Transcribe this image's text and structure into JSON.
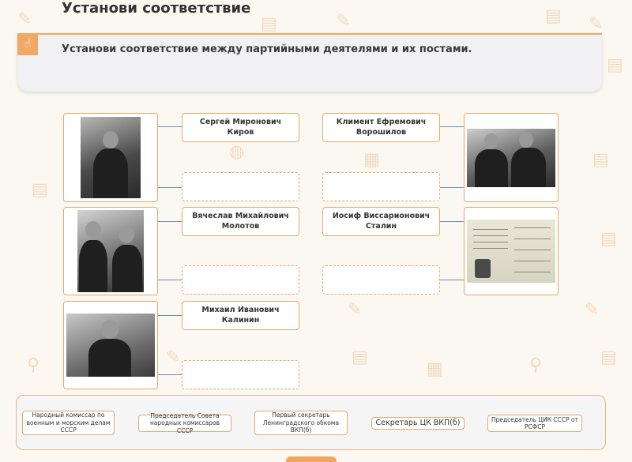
{
  "page": {
    "title": "Установи соответствие",
    "instruction": "Установи соответствие между партийными деятелями и их постами."
  },
  "names": {
    "kirov": "Сергей Миронович Киров",
    "voroshilov": "Климент Ефремович Ворошилов",
    "molotov": "Вячеслав Михайлович Молотов",
    "stalin": "Иосиф Виссарионович Сталин",
    "kalinin": "Михаил Иванович Калинин"
  },
  "options": [
    "Народный комиссар по военным и морским делам СССР",
    "Председатель Совета народных комиссаров СССР",
    "Первый секретарь Ленинградского обкома ВКП(б)",
    "Секретарь ЦК ВКП(б)",
    "Председатель ЦИК СССР от РСФСР"
  ],
  "icons": {
    "task_badge": "pointer-hand-icon"
  },
  "colors": {
    "accent": "#f0a866",
    "connector": "#6f8fb3"
  }
}
